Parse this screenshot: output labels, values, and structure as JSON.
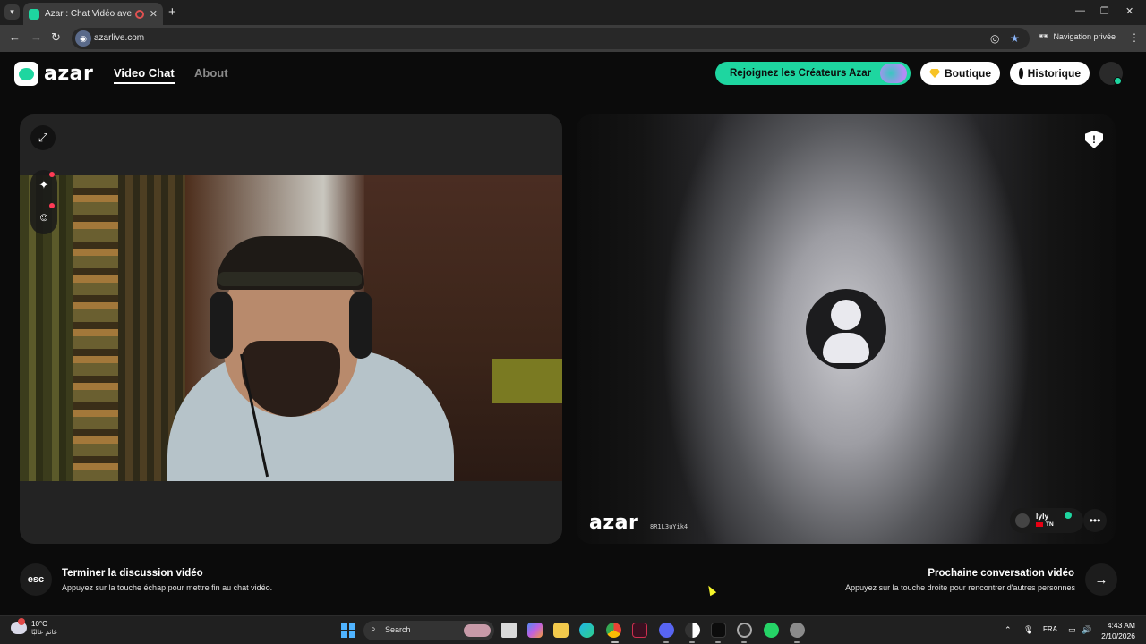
{
  "browser": {
    "tab_title": "Azar : Chat Vidéo avec de n",
    "url": "azarlive.com",
    "incognito_label": "Navigation privée",
    "new_tab_glyph": "+",
    "tab_close_glyph": "✕"
  },
  "header": {
    "logo_text": "azar",
    "nav": [
      {
        "label": "Video Chat",
        "active": true
      },
      {
        "label": "About",
        "active": false
      }
    ],
    "creator_button": "Rejoignez les Créateurs Azar",
    "shop_button": "Boutique",
    "history_button": "Historique"
  },
  "partner": {
    "watermark": "azar",
    "session_id": "8R1L3uYik4",
    "name": "lyly",
    "country_code": "TN"
  },
  "hints": {
    "esc_key": "esc",
    "end_title": "Terminer la discussion vidéo",
    "end_sub": "Appuyez sur la touche échap pour mettre fin au chat vidéo.",
    "next_title": "Prochaine conversation vidéo",
    "next_sub": "Appuyez sur la touche droite pour rencontrer d'autres personnes"
  },
  "taskbar": {
    "weather_temp": "10°C",
    "weather_desc": "غائم غالبًا",
    "search_placeholder": "Search",
    "language": "FRA",
    "time": "4:43 AM",
    "date": "2/10/2026"
  },
  "icons": {
    "expand": "expand-icon",
    "magic": "magic-wand-icon",
    "sticker": "smiley-icon",
    "report": "shield-alert-icon",
    "chat": "chat-bubble-icon",
    "next": "arrow-right-icon"
  },
  "colors": {
    "brand": "#1ed6a0",
    "shop_gem": "#f7c325",
    "notification": "#ff3b55"
  }
}
